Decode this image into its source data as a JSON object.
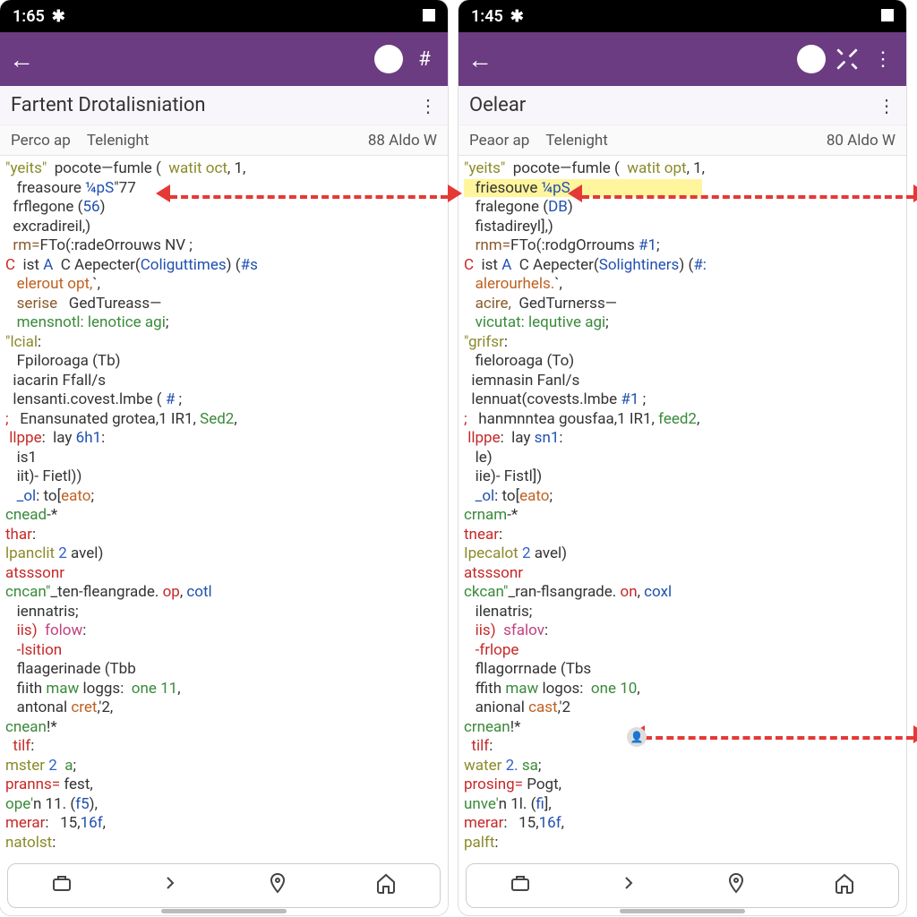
{
  "left": {
    "status_time": "1:65",
    "appbar": {
      "back": "←"
    },
    "titlebar": {
      "title": "Fartent Drotalisniation",
      "more": "⋮"
    },
    "subbar": {
      "t1": "Perco ap",
      "t2": "Telenight",
      "t3": "88 Aldo W"
    },
    "code": [
      {
        "t": "\"yeits\"",
        "c": "id"
      },
      {
        "t": "  pocote—fumle (  "
      },
      {
        "t": "watit oct",
        "c": "str"
      },
      {
        "t": ", 1,",
        "nl": 1
      },
      {
        "t": "   freasoure "
      },
      {
        "t": "¼pS",
        "c": "fn"
      },
      {
        "t": "\"77",
        "nl": 1,
        "arrowStart": true
      },
      {
        "t": "  frflegone ("
      },
      {
        "t": "56",
        "c": "fn"
      },
      {
        "t": ")",
        "nl": 1
      },
      {
        "t": "  excradireil,)",
        "nl": 1
      },
      {
        "t": "  rm=",
        "c": "br"
      },
      {
        "t": "FTo(:radeOrrouws NV ;",
        "nl": 1
      },
      {
        "t": "C",
        "c": "kw"
      },
      {
        "t": "  ist "
      },
      {
        "t": "A",
        "c": "fn"
      },
      {
        "t": "  C Aepecter("
      },
      {
        "t": "Coliguttimes",
        "c": "fn"
      },
      {
        "t": ") ("
      },
      {
        "t": "#s",
        "c": "fn"
      },
      {
        "nl": 1
      },
      {
        "t": "   elerout opt,",
        "c": "or"
      },
      {
        "t": "`,",
        "nl": 1
      },
      {
        "t": "   serise",
        "c": "br"
      },
      {
        "t": "   GedTureass—",
        "nl": 1
      },
      {
        "t": "   mensnotl",
        "c": "gr"
      },
      {
        "t": ": lenotice agi",
        "c": "gr"
      },
      {
        "t": ";",
        "nl": 1
      },
      {
        "t": "\"lcial",
        "c": "id"
      },
      {
        "t": ":",
        "nl": 1
      },
      {
        "t": "   Fpiloroaga (Tb)",
        "nl": 1
      },
      {
        "t": "  iacarin Ffall/s",
        "nl": 1
      },
      {
        "t": "  lensanti.covest.lmbe ( "
      },
      {
        "t": "#",
        "c": "fn"
      },
      {
        "t": " ;",
        "nl": 1
      },
      {
        "t": ";",
        "c": "kw"
      },
      {
        "t": "   Enansunated grotea,1 IR1, "
      },
      {
        "t": "Sed2",
        "c": "gr"
      },
      {
        "t": ",",
        "nl": 1
      },
      {
        "t": " llppe",
        "c": "kw"
      },
      {
        "t": ":  lay "
      },
      {
        "t": "6h1",
        "c": "fn"
      },
      {
        "t": ":",
        "nl": 1
      },
      {
        "t": "   is1",
        "nl": 1
      },
      {
        "t": "   iit)- Fietl))",
        "nl": 1
      },
      {
        "t": "   _ol",
        "c": "fn"
      },
      {
        "t": ": to["
      },
      {
        "t": "eato",
        "c": "or"
      },
      {
        "t": ";",
        "nl": 1
      },
      {
        "t": "cnead",
        "c": "gr"
      },
      {
        "t": "-*",
        "nl": 1
      },
      {
        "t": "thar",
        "c": "kw"
      },
      {
        "t": ":",
        "nl": 1
      },
      {
        "t": "lpanclit",
        "c": "id"
      },
      {
        "t": " 2",
        "c": "num"
      },
      {
        "t": " avel)",
        "nl": 1
      },
      {
        "t": "atsssonr",
        "c": "kw"
      },
      {
        "nl": 1
      },
      {
        "t": "cncan\"",
        "c": "gr"
      },
      {
        "t": "_ten-fleangrade. "
      },
      {
        "t": "op",
        "c": "kw"
      },
      {
        "t": ", "
      },
      {
        "t": "cotl",
        "c": "fn"
      },
      {
        "nl": 1
      },
      {
        "t": "   iennatris;",
        "nl": 1
      },
      {
        "t": "   iis)",
        "c": "kw"
      },
      {
        "t": "  "
      },
      {
        "t": "folow",
        "c": "pk"
      },
      {
        "t": ":",
        "nl": 1
      },
      {
        "t": "   -lsition",
        "c": "kw"
      },
      {
        "nl": 1
      },
      {
        "t": "   flaagerinade (Tbb",
        "nl": 1
      },
      {
        "t": "   fiith "
      },
      {
        "t": "maw",
        "c": "gr"
      },
      {
        "t": " loggs:  "
      },
      {
        "t": "one 11",
        "c": "gr"
      },
      {
        "t": ",",
        "nl": 1
      },
      {
        "t": "   antonal "
      },
      {
        "t": "cret",
        "c": "or"
      },
      {
        "t": ",'2,",
        "nl": 1
      },
      {
        "t": "cnean",
        "c": "gr"
      },
      {
        "t": "!*",
        "nl": 1
      },
      {
        "t": "  tilf",
        "c": "kw"
      },
      {
        "t": ":",
        "nl": 1
      },
      {
        "t": "mster",
        "c": "id"
      },
      {
        "t": " 2",
        "c": "num"
      },
      {
        "t": "  a",
        "c": "gr"
      },
      {
        "t": ";",
        "nl": 1
      },
      {
        "t": "pranns=",
        "c": "kw"
      },
      {
        "t": " fest,",
        "nl": 1
      },
      {
        "t": "ope'",
        "c": "gr"
      },
      {
        "t": "n 11. ("
      },
      {
        "t": "f5",
        "c": "fn"
      },
      {
        "t": "),",
        "nl": 1
      },
      {
        "t": "merar",
        "c": "kw"
      },
      {
        "t": ":   15,"
      },
      {
        "t": "16f",
        "c": "fn"
      },
      {
        "t": ",",
        "nl": 1
      },
      {
        "t": "natolst",
        "c": "id"
      },
      {
        "t": ":",
        "nl": 1
      }
    ]
  },
  "right": {
    "status_time": "1:45",
    "appbar": {
      "back": "←"
    },
    "titlebar": {
      "title": "Oelear",
      "more": "⋮"
    },
    "subbar": {
      "t1": "Peaor ap",
      "t2": "Telenight",
      "t3": "80 Aldo W"
    },
    "code": [
      {
        "t": "\"yeits\"",
        "c": "id"
      },
      {
        "t": "  pocote—fumle (  "
      },
      {
        "t": "watit opt",
        "c": "str"
      },
      {
        "t": ", 1,",
        "nl": 1
      },
      {
        "t": "   friesouve ",
        "hl": 1
      },
      {
        "t": "¼pS",
        "c": "fn",
        "hl": 1
      },
      {
        "t": "                                   ",
        "hl": 1,
        "nl": 1,
        "arrowStart2": true
      },
      {
        "t": "   fralegone ("
      },
      {
        "t": "DB",
        "c": "fn"
      },
      {
        "t": ")",
        "nl": 1
      },
      {
        "t": "   fistadireyl],)",
        "nl": 1
      },
      {
        "t": "   rnm=",
        "c": "br"
      },
      {
        "t": "FTo(:rodgOrroums "
      },
      {
        "t": "#1",
        "c": "fn"
      },
      {
        "t": ";",
        "nl": 1
      },
      {
        "t": "C",
        "c": "kw"
      },
      {
        "t": "  ist "
      },
      {
        "t": "A",
        "c": "fn"
      },
      {
        "t": "  C Aepecter("
      },
      {
        "t": "Solightiners",
        "c": "fn"
      },
      {
        "t": ") ("
      },
      {
        "t": "#:",
        "c": "fn"
      },
      {
        "nl": 1
      },
      {
        "t": "   alerourhels.",
        "c": "or"
      },
      {
        "t": "`,",
        "nl": 1
      },
      {
        "t": "   acire,",
        "c": "br"
      },
      {
        "t": "  GedTurnerss—",
        "nl": 1
      },
      {
        "t": "   vicutat",
        "c": "gr"
      },
      {
        "t": ": lequtive agi",
        "c": "gr"
      },
      {
        "t": ";",
        "nl": 1
      },
      {
        "t": "\"grifsr",
        "c": "id"
      },
      {
        "t": ":",
        "nl": 1
      },
      {
        "t": "   fieloroaga (To)",
        "nl": 1
      },
      {
        "t": "  iemnasin Fanl/s",
        "nl": 1
      },
      {
        "t": "  lennuat(covests.lmbe "
      },
      {
        "t": "#1",
        "c": "fn"
      },
      {
        "t": " ;",
        "nl": 1
      },
      {
        "t": ";",
        "c": "kw"
      },
      {
        "t": "   hanmnntea gousfaa,1 IR1, "
      },
      {
        "t": "feed2",
        "c": "gr"
      },
      {
        "t": ",",
        "nl": 1
      },
      {
        "t": " llppe",
        "c": "kw"
      },
      {
        "t": ":  lay "
      },
      {
        "t": "sn1",
        "c": "fn"
      },
      {
        "t": ":",
        "nl": 1
      },
      {
        "t": "   le)",
        "nl": 1
      },
      {
        "t": "   iie)- Fistl])",
        "nl": 1
      },
      {
        "t": "   _ol",
        "c": "fn"
      },
      {
        "t": ": to["
      },
      {
        "t": "eato",
        "c": "or"
      },
      {
        "t": ";",
        "nl": 1
      },
      {
        "t": "crnam",
        "c": "gr"
      },
      {
        "t": "-*",
        "nl": 1
      },
      {
        "t": "tnear",
        "c": "kw"
      },
      {
        "t": ":",
        "nl": 1
      },
      {
        "t": "Ipecalot",
        "c": "id"
      },
      {
        "t": " 2",
        "c": "num"
      },
      {
        "t": " avel)",
        "nl": 1
      },
      {
        "t": "atsssonr",
        "c": "kw"
      },
      {
        "nl": 1
      },
      {
        "t": "ckcan\"",
        "c": "gr"
      },
      {
        "t": "_ran-flsangrade. "
      },
      {
        "t": "on",
        "c": "kw"
      },
      {
        "t": ", "
      },
      {
        "t": "coxl",
        "c": "fn"
      },
      {
        "nl": 1
      },
      {
        "t": "   ilenatris;",
        "nl": 1
      },
      {
        "t": "   iis)",
        "c": "kw"
      },
      {
        "t": "  "
      },
      {
        "t": "sfalov",
        "c": "pk"
      },
      {
        "t": ":",
        "nl": 1
      },
      {
        "t": "   -frlope",
        "c": "kw"
      },
      {
        "nl": 1
      },
      {
        "t": "   fllagorrnade (Tbs",
        "nl": 1
      },
      {
        "t": "   ffith "
      },
      {
        "t": "maw",
        "c": "gr"
      },
      {
        "t": " logos:  "
      },
      {
        "t": "one 10",
        "c": "gr"
      },
      {
        "t": ",",
        "nl": 1
      },
      {
        "t": "   anional "
      },
      {
        "t": "cast",
        "c": "or"
      },
      {
        "t": ",'2",
        "nl": 1,
        "avatar": true
      },
      {
        "t": "crnean",
        "c": "gr"
      },
      {
        "t": "!*",
        "nl": 1
      },
      {
        "t": "  tilf",
        "c": "kw"
      },
      {
        "t": ":",
        "nl": 1
      },
      {
        "t": "water",
        "c": "id"
      },
      {
        "t": " 2.",
        "c": "num"
      },
      {
        "t": " sa",
        "c": "gr"
      },
      {
        "t": ";",
        "nl": 1
      },
      {
        "t": "prosing=",
        "c": "kw"
      },
      {
        "t": " Pogt,",
        "nl": 1
      },
      {
        "t": "unve'",
        "c": "gr"
      },
      {
        "t": "n 1l. ("
      },
      {
        "t": "fi",
        "c": "fn"
      },
      {
        "t": "],",
        "nl": 1
      },
      {
        "t": "merar",
        "c": "kw"
      },
      {
        "t": ":   15,"
      },
      {
        "t": "16f",
        "c": "fn"
      },
      {
        "t": ",",
        "nl": 1
      },
      {
        "t": "palft",
        "c": "id"
      },
      {
        "t": ":",
        "nl": 1
      }
    ]
  }
}
